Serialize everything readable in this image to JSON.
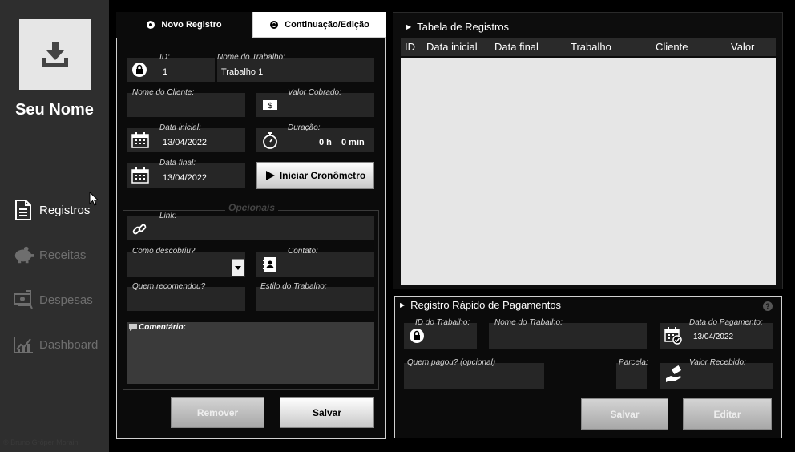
{
  "sidebar": {
    "user_name": "Seu Nome",
    "copyright": "© Bruno Gröper Morain",
    "items": [
      {
        "label": "Registros",
        "icon": "document-icon",
        "active": true
      },
      {
        "label": "Receitas",
        "icon": "piggy-bank-icon",
        "active": false
      },
      {
        "label": "Despesas",
        "icon": "money-stack-icon",
        "active": false
      },
      {
        "label": "Dashboard",
        "icon": "line-chart-icon",
        "active": false
      }
    ]
  },
  "form": {
    "tabs": [
      "Novo Registro",
      "Continuação/Edição"
    ],
    "id_label": "ID:",
    "id_value": "1",
    "job_name_label": "Nome do Trabalho:",
    "job_name_value": "Trabalho 1",
    "client_label": "Nome do Cliente:",
    "client_value": "",
    "charged_label": "Valor Cobrado:",
    "charged_value": "",
    "start_date_label": "Data inicial:",
    "start_date_value": "13/04/2022",
    "duration_label": "Duração:",
    "duration_hours": "0 h",
    "duration_minutes": "0 min",
    "end_date_label": "Data final:",
    "end_date_value": "13/04/2022",
    "timer_button": "Iniciar Cronômetro",
    "optional_title": "Opcionais",
    "link_label": "Link:",
    "discovered_label": "Como descobriu?",
    "contact_label": "Contato:",
    "referred_label": "Quem recomendou?",
    "style_label": "Estilo do Trabalho:",
    "comment_label": "Comentário:",
    "remove_button": "Remover",
    "save_button": "Salvar"
  },
  "table": {
    "title": "Tabela de Registros",
    "columns": [
      "ID",
      "Data inicial",
      "Data final",
      "Trabalho",
      "Cliente",
      "Valor"
    ],
    "rows": []
  },
  "payment": {
    "title": "Registro Rápido de Pagamentos",
    "job_id_label": "ID do Trabalho:",
    "job_name_label": "Nome do Trabalho:",
    "date_label": "Data do Pagamento:",
    "date_value": "13/04/2022",
    "payer_label": "Quem pagou? (opcional)",
    "installment_label": "Parcela:",
    "received_label": "Valor Recebido:",
    "save_button": "Salvar",
    "edit_button": "Editar",
    "help": "?"
  },
  "colors": {
    "sidebar_bg": "#2e2e2e",
    "panel_bg": "#0b0b0b",
    "field_bg": "#262626",
    "table_body_bg": "#e6e6e6"
  }
}
